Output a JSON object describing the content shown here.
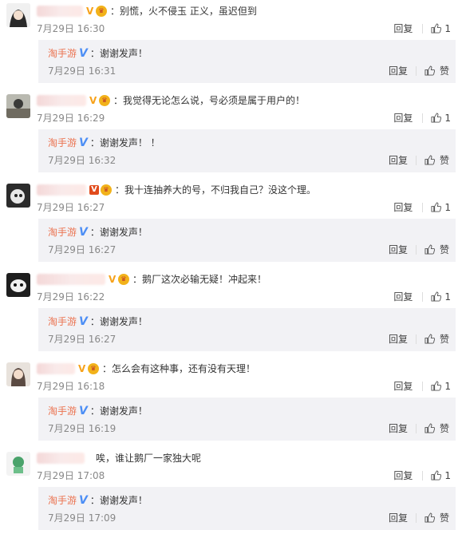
{
  "ui": {
    "reply_label": "回复",
    "like_label": "赞",
    "replier_name": "淘手游",
    "replier_badge": "V"
  },
  "comments": [
    {
      "text": "：别慌，火不侵玉 正义，虽迟但到",
      "time": "7月29日 16:30",
      "like_count": "1",
      "reply": {
        "text": "：谢谢发声！",
        "time": "7月29日 16:31"
      }
    },
    {
      "text": "：我觉得无论怎么说，号必须是属于用户的！",
      "time": "7月29日 16:29",
      "like_count": "1",
      "reply": {
        "text": "：谢谢发声！ ！",
        "time": "7月29日 16:32"
      }
    },
    {
      "text": "：我十连抽养大的号，不归我自己？没这个理。",
      "time": "7月29日 16:27",
      "like_count": "1",
      "reply": {
        "text": "：谢谢发声！",
        "time": "7月29日 16:27"
      }
    },
    {
      "text": "：鹅厂这次必输无疑！冲起来！",
      "time": "7月29日 16:22",
      "like_count": "1",
      "reply": {
        "text": "：谢谢发声！",
        "time": "7月29日 16:27"
      }
    },
    {
      "text": "：怎么会有这种事，还有没有天理！",
      "time": "7月29日 16:18",
      "like_count": "1",
      "reply": {
        "text": "：谢谢发声！",
        "time": "7月29日 16:19"
      }
    },
    {
      "text": "唉，谁让鹅厂一家独大呢",
      "time": "7月29日 17:08",
      "like_count": "1",
      "reply": {
        "text": "：谢谢发声！",
        "time": "7月29日 17:09"
      }
    }
  ]
}
